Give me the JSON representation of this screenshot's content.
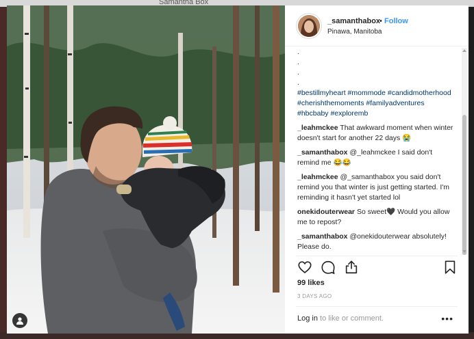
{
  "backdrop": {
    "top_text": "Samantha Box"
  },
  "post": {
    "username": "_samanthabox",
    "separator": "•",
    "follow_label": "Follow",
    "location": "Pinawa, Manitoba",
    "caption_dots": [
      ".",
      ".",
      ".",
      "."
    ],
    "hashtags": "#bestillmyheart #mommode #candidmotherhood #cherishthemoments #familyadventures #hbcbaby #exploremb",
    "comments": [
      {
        "user": "_leahmckee",
        "text": "That awkward moment when winter doesn't start for another 22 days 😭"
      },
      {
        "user": "_samanthabox",
        "text": "@_leahmckee I said don't remind me 😂😂"
      },
      {
        "user": "_leahmckee",
        "text": "@_samanthabox you said don't remind you that winter is just getting started. I'm reminding it hasn't yet started lol"
      },
      {
        "user": "onekidouterwear",
        "text": "So sweet🖤 Would you allow me to repost?"
      },
      {
        "user": "_samanthabox",
        "text": "@onekidouterwear absolutely! Please do."
      }
    ],
    "likes": "99 likes",
    "timestamp": "3 DAYS AGO",
    "login_link": "Log in",
    "login_rest": " to like or comment.",
    "more_label": "•••"
  },
  "icons": {
    "like": "heart-icon",
    "comment": "comment-icon",
    "share": "share-icon",
    "save": "bookmark-icon",
    "tag": "user-tag-icon"
  }
}
